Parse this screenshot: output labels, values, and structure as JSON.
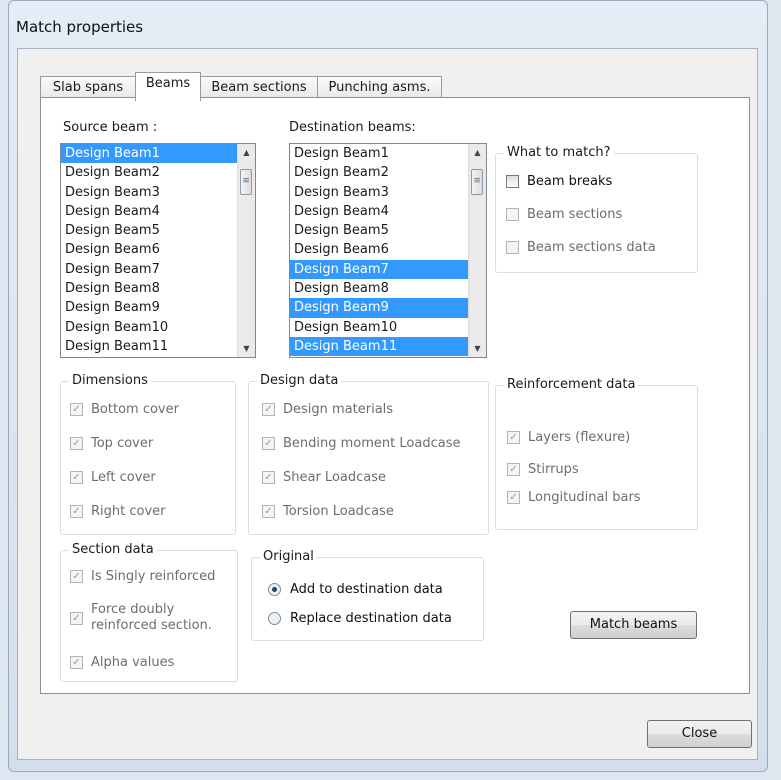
{
  "window": {
    "title": "Match properties"
  },
  "tabs": [
    {
      "label": "Slab spans"
    },
    {
      "label": "Beams"
    },
    {
      "label": "Beam sections"
    },
    {
      "label": "Punching asms."
    }
  ],
  "source": {
    "label": "Source beam :",
    "items": [
      "Design Beam1",
      "Design Beam2",
      "Design Beam3",
      "Design Beam4",
      "Design Beam5",
      "Design Beam6",
      "Design Beam7",
      "Design Beam8",
      "Design Beam9",
      "Design Beam10",
      "Design Beam11"
    ],
    "selected": [
      "Design Beam1"
    ]
  },
  "destination": {
    "label": "Destination beams:",
    "items": [
      "Design Beam1",
      "Design Beam2",
      "Design Beam3",
      "Design Beam4",
      "Design Beam5",
      "Design Beam6",
      "Design Beam7",
      "Design Beam8",
      "Design Beam9",
      "Design Beam10",
      "Design Beam11"
    ],
    "selected": [
      "Design Beam7",
      "Design Beam9",
      "Design Beam11"
    ]
  },
  "what_to_match": {
    "title": "What to match?",
    "options": [
      {
        "label": "Beam breaks",
        "checked": false,
        "enabled": true
      },
      {
        "label": "Beam sections",
        "checked": false,
        "enabled": false
      },
      {
        "label": "Beam sections data",
        "checked": false,
        "enabled": false
      }
    ]
  },
  "dimensions": {
    "title": "Dimensions",
    "options": [
      {
        "label": "Bottom cover",
        "checked": true
      },
      {
        "label": "Top cover",
        "checked": true
      },
      {
        "label": "Left cover",
        "checked": true
      },
      {
        "label": "Right cover",
        "checked": true
      }
    ]
  },
  "design_data": {
    "title": "Design data",
    "options": [
      {
        "label": "Design materials",
        "checked": true
      },
      {
        "label": "Bending moment Loadcase",
        "checked": true
      },
      {
        "label": "Shear Loadcase",
        "checked": true
      },
      {
        "label": "Torsion Loadcase",
        "checked": true
      }
    ]
  },
  "reinforcement_data": {
    "title": "Reinforcement data",
    "options": [
      {
        "label": "Layers (flexure)",
        "checked": true
      },
      {
        "label": "Stirrups",
        "checked": true
      },
      {
        "label": "Longitudinal bars",
        "checked": true
      }
    ]
  },
  "section_data": {
    "title": "Section data",
    "options": [
      {
        "label": "Is Singly reinforced",
        "checked": true
      },
      {
        "label": "Force doubly reinforced section.",
        "checked": true
      },
      {
        "label": "Alpha values",
        "checked": true
      }
    ],
    "force_lines": [
      "Force doubly",
      "reinforced section."
    ]
  },
  "original": {
    "title": "Original",
    "options": [
      {
        "label": "Add to destination data",
        "selected": true
      },
      {
        "label": "Replace destination data",
        "selected": false
      }
    ]
  },
  "buttons": {
    "match": "Match beams",
    "close": "Close"
  },
  "colors": {
    "selection": "#3399ff",
    "window_bg": "#dfe8f1",
    "panel_bg": "#ffffff"
  }
}
